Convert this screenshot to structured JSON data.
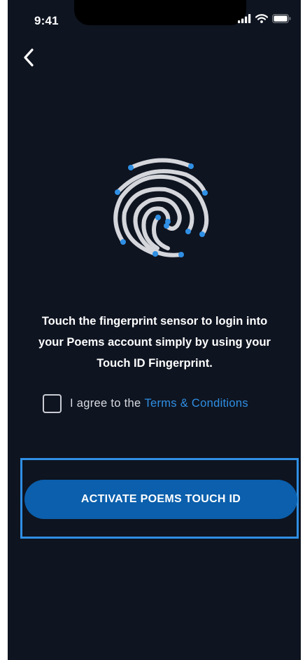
{
  "status_bar": {
    "time": "9:41"
  },
  "icons": {
    "back": "chevron-left-icon",
    "fingerprint": "fingerprint-icon",
    "signal": "signal-icon",
    "wifi": "wifi-icon",
    "battery": "battery-icon"
  },
  "message": {
    "line1": "Touch the fingerprint sensor to login into",
    "line2": "your Poems account simply by using your",
    "line3": "Touch ID Fingerprint."
  },
  "agreement": {
    "checked": false,
    "prefix": "I agree to the",
    "link": "Terms & Conditions"
  },
  "activate_button": {
    "label": "ACTIVATE POEMS TOUCH ID"
  },
  "colors": {
    "background": "#0e1420",
    "accent": "#2f8fe4",
    "button": "#0b5fac",
    "fingerprint_ridge": "#d4d6dc"
  }
}
